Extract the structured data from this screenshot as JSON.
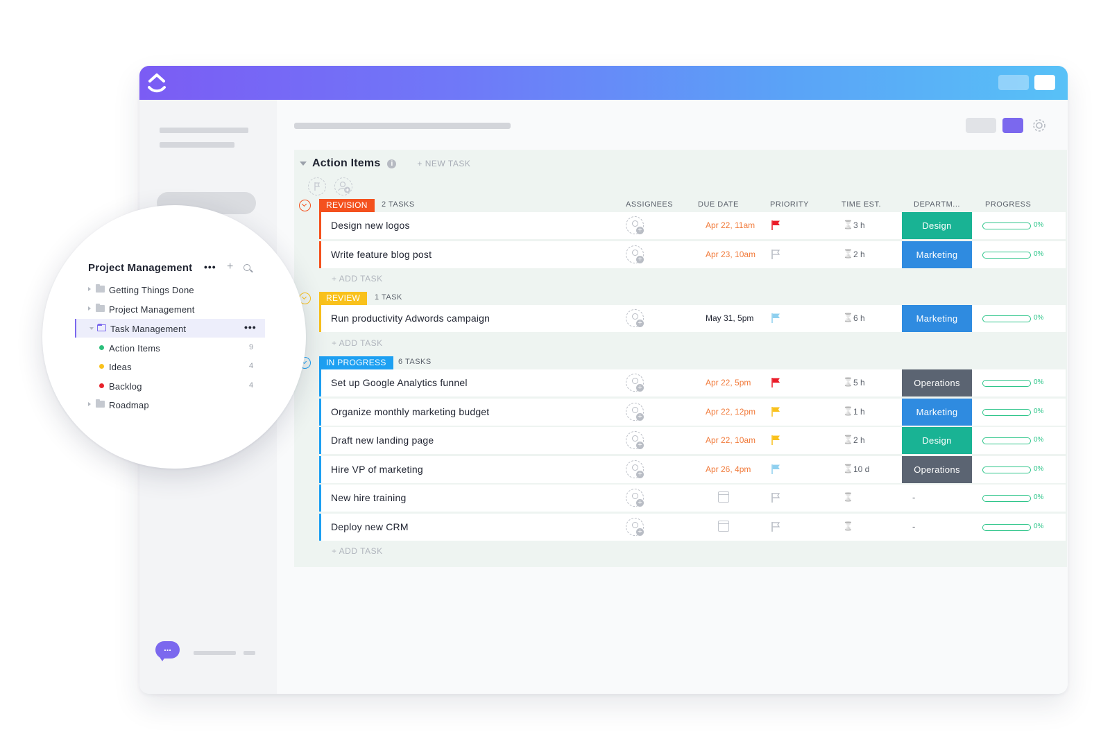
{
  "colors": {
    "brand_purple": "#7b68ee",
    "revision": "#f4511e",
    "review": "#f9c11c",
    "in_progress": "#1ea0f2",
    "design": "#19b394",
    "marketing": "#2f8be0",
    "operations": "#5b6472",
    "due_overdue": "#f17a3a",
    "due_normal": "#1f2330",
    "flag_urgent": "#ea1b28",
    "flag_high": "#f9c11c",
    "flag_normal": "#8fd0ef",
    "flag_empty": "#b3b8c0",
    "progress": "#2ec58a"
  },
  "list": {
    "title": "Action Items",
    "info_icon": "info-icon",
    "new_task_label": "+ NEW TASK"
  },
  "columns": {
    "assignees": "ASSIGNEES",
    "due_date": "DUE DATE",
    "priority": "PRIORITY",
    "time_est": "TIME EST.",
    "department": "DEPARTM...",
    "progress": "PROGRESS"
  },
  "add_task_label": "+ ADD TASK",
  "groups": [
    {
      "status": "REVISION",
      "count": "2 TASKS",
      "color_key": "revision",
      "tasks": [
        {
          "name": "Design new logos",
          "due": "Apr 22, 11am",
          "due_style": "due_overdue",
          "priority": "flag_urgent",
          "time": "3 h",
          "department": "Design",
          "dept_color": "design",
          "progress_pct": 0,
          "progress_label": "0%"
        },
        {
          "name": "Write feature blog post",
          "due": "Apr 23, 10am",
          "due_style": "due_overdue",
          "priority": "flag_empty",
          "time": "2 h",
          "department": "Marketing",
          "dept_color": "marketing",
          "progress_pct": 0,
          "progress_label": "0%"
        }
      ]
    },
    {
      "status": "REVIEW",
      "count": "1 TASK",
      "color_key": "review",
      "tasks": [
        {
          "name": "Run productivity Adwords campaign",
          "due": "May 31, 5pm",
          "due_style": "due_normal",
          "priority": "flag_normal",
          "time": "6 h",
          "department": "Marketing",
          "dept_color": "marketing",
          "progress_pct": 0,
          "progress_label": "0%"
        }
      ]
    },
    {
      "status": "IN PROGRESS",
      "count": "6 TASKS",
      "color_key": "in_progress",
      "tasks": [
        {
          "name": "Set up Google Analytics funnel",
          "due": "Apr 22, 5pm",
          "due_style": "due_overdue",
          "priority": "flag_urgent",
          "time": "5 h",
          "department": "Operations",
          "dept_color": "operations",
          "progress_pct": 0,
          "progress_label": "0%"
        },
        {
          "name": "Organize monthly marketing budget",
          "due": "Apr 22, 12pm",
          "due_style": "due_overdue",
          "priority": "flag_high",
          "time": "1 h",
          "department": "Marketing",
          "dept_color": "marketing",
          "progress_pct": 0,
          "progress_label": "0%"
        },
        {
          "name": "Draft new landing page",
          "due": "Apr 22, 10am",
          "due_style": "due_overdue",
          "priority": "flag_high",
          "time": "2 h",
          "department": "Design",
          "dept_color": "design",
          "progress_pct": 0,
          "progress_label": "0%"
        },
        {
          "name": "Hire VP of marketing",
          "due": "Apr 26, 4pm",
          "due_style": "due_overdue",
          "priority": "flag_normal",
          "time": "10 d",
          "department": "Operations",
          "dept_color": "operations",
          "progress_pct": 0,
          "progress_label": "0%"
        },
        {
          "name": "New hire training",
          "due": "",
          "due_style": "due_normal",
          "priority": "flag_empty",
          "time": "",
          "department": "-",
          "dept_color": "",
          "progress_pct": 0,
          "progress_label": "0%"
        },
        {
          "name": "Deploy new CRM",
          "due": "",
          "due_style": "due_normal",
          "priority": "flag_empty",
          "time": "",
          "department": "-",
          "dept_color": "",
          "progress_pct": 0,
          "progress_label": "0%"
        }
      ]
    }
  ],
  "sidebar_popup": {
    "title": "Project Management",
    "more_label": "•••",
    "add_label": "+",
    "items": [
      {
        "label": "Getting Things Done",
        "kind": "folder"
      },
      {
        "label": "Project Management",
        "kind": "folder"
      },
      {
        "label": "Task Management",
        "kind": "folder-open",
        "more": "•••"
      },
      {
        "label": "Action Items",
        "kind": "list",
        "dot": "#2bbf7b",
        "count": "9"
      },
      {
        "label": "Ideas",
        "kind": "list",
        "dot": "#f9c11c",
        "count": "4"
      },
      {
        "label": "Backlog",
        "kind": "list",
        "dot": "#e8222b",
        "count": "4"
      },
      {
        "label": "Roadmap",
        "kind": "folder"
      }
    ]
  },
  "chat_label": "..."
}
